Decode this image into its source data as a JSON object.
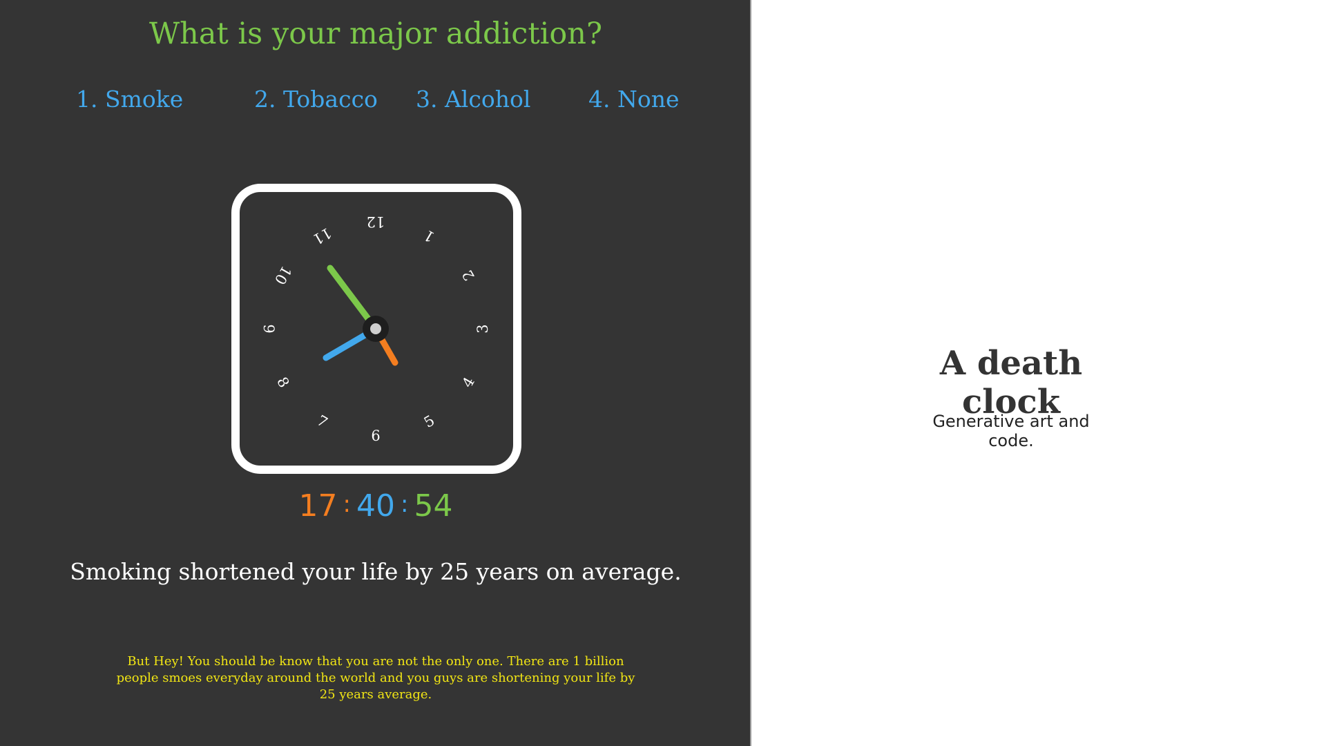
{
  "question": "What is your major addiction?",
  "options": [
    {
      "label": "1. Smoke"
    },
    {
      "label": "2. Tobacco"
    },
    {
      "label": "3. Alcohol"
    },
    {
      "label": "4. None"
    }
  ],
  "clock": {
    "numerals": [
      "12",
      "1",
      "2",
      "3",
      "4",
      "5",
      "6",
      "7",
      "8",
      "9",
      "10",
      "11"
    ],
    "hands": {
      "hour_color": "#42a8ec",
      "minute_color": "#7cc84a",
      "second_color": "#f47e20"
    }
  },
  "digital_time": {
    "hours": "17",
    "minutes": "40",
    "seconds": "54",
    "separator": ":",
    "hours_color": "#f47e20",
    "minutes_color": "#42a8ec",
    "seconds_color": "#7cc84a"
  },
  "message": "Smoking shortened your life by 25 years on average.",
  "footnote": "But Hey! You should be know that you are not the only one. There are 1 billion people smoes everyday around the world and you guys are shortening your life by 25 years average.",
  "right_panel": {
    "title": "A death clock",
    "subtitle": "Generative art and code."
  },
  "colors": {
    "panel_bg": "#343434",
    "accent_green": "#7cc84a",
    "accent_blue": "#42a8ec",
    "accent_orange": "#f47e20",
    "footnote_yellow": "#f2e614"
  }
}
